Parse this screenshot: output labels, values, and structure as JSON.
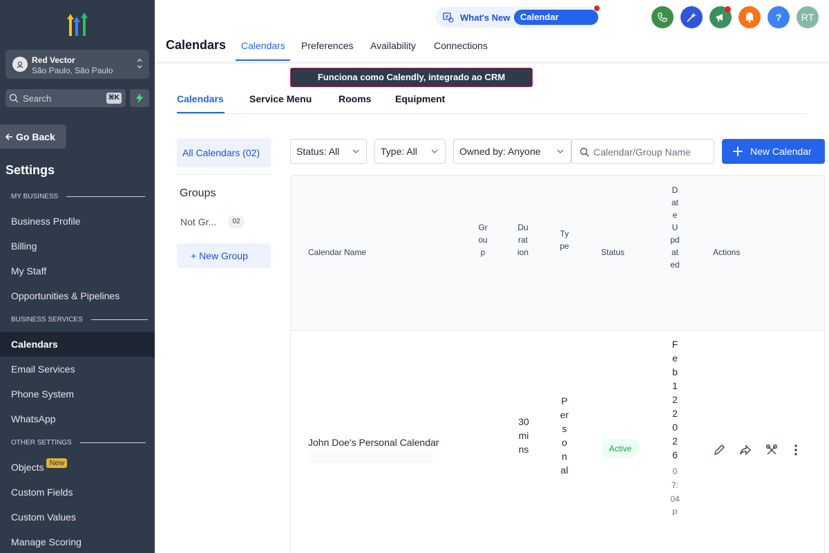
{
  "sidebar": {
    "account_name": "Red Vector",
    "account_location": "São Paulo, São Paulo",
    "search_placeholder": "Search",
    "search_shortcut": "⌘K",
    "go_back": "Go Back",
    "title": "Settings",
    "sections": {
      "my_business": "MY BUSINESS",
      "business_services": "BUSINESS SERVICES",
      "other_settings": "OTHER SETTINGS"
    },
    "items": {
      "business_profile": "Business Profile",
      "billing": "Billing",
      "my_staff": "My Staff",
      "opportunities": "Opportunities & Pipelines",
      "calendars": "Calendars",
      "email_services": "Email Services",
      "phone_system": "Phone System",
      "whatsapp": "WhatsApp",
      "objects": "Objects",
      "objects_badge": "New",
      "custom_fields": "Custom Fields",
      "custom_values": "Custom Values",
      "manage_scoring": "Manage Scoring"
    }
  },
  "topbar": {
    "whats_new": "What's New",
    "calendar_updates": "Calendar Updates",
    "avatar_initials": "RT",
    "help": "?",
    "colors": {
      "phone": "#3d8f47",
      "magic": "#2f56d8",
      "megaphone": "#3d8f5f",
      "bell": "#f97316",
      "help": "#3b82f6",
      "avatar": "#86b8a8"
    }
  },
  "header": {
    "title": "Calendars",
    "tabs": {
      "calendars": "Calendars",
      "preferences": "Preferences",
      "availability": "Availability",
      "connections": "Connections"
    }
  },
  "banner": "Funciona como Calendly, integrado ao CRM",
  "subtabs": {
    "calendars": "Calendars",
    "service_menu": "Service Menu",
    "rooms": "Rooms",
    "equipment": "Equipment"
  },
  "groups": {
    "all_calendars": "All Calendars (02)",
    "heading": "Groups",
    "not_grouped": "Not Gr...",
    "not_grouped_count": "02",
    "new_group": "+ New Group"
  },
  "filters": {
    "status": "Status: All",
    "type": "Type: All",
    "owned_by": "Owned by: Anyone",
    "search_placeholder": "Calendar/Group Name",
    "new_calendar": "New Calendar"
  },
  "table": {
    "headers": {
      "name": "Calendar Name",
      "group": "Group",
      "duration": "Duration",
      "type": "Type",
      "status": "Status",
      "date_updated": "DateUpdated",
      "actions": "Actions"
    },
    "rows": [
      {
        "name": "John Doe's Personal Calendar",
        "duration": "30mins",
        "type": "Personal",
        "status": "Active",
        "date": "Feb122026",
        "time": "07:04P"
      }
    ]
  }
}
